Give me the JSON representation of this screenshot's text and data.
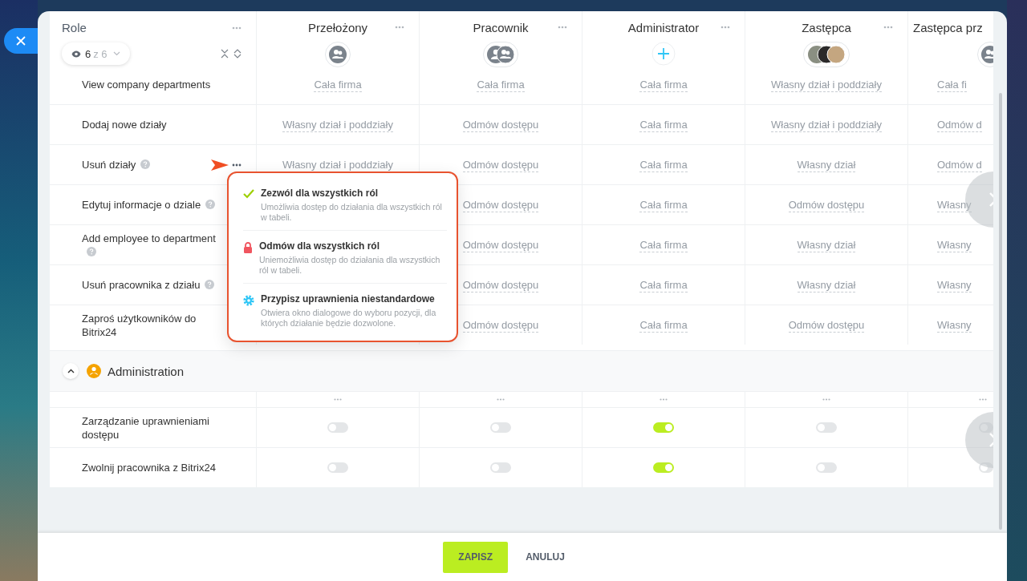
{
  "roles": {
    "title": "Role",
    "filter": {
      "count": "6",
      "total": "z 6"
    }
  },
  "columns": [
    {
      "name": "Przełożony",
      "avatar": {
        "kind": "group"
      }
    },
    {
      "name": "Pracownik",
      "avatar": {
        "kind": "user_group"
      }
    },
    {
      "name": "Administrator",
      "avatar": {
        "kind": "add"
      }
    },
    {
      "name": "Zastępca",
      "avatar": {
        "kind": "photos"
      }
    },
    {
      "name": "Zastępca prz",
      "avatar": {
        "kind": "group"
      }
    }
  ],
  "rows": [
    {
      "label": "View company departments",
      "help": false,
      "values": [
        "Cała firma",
        "Cała firma",
        "Cała firma",
        "Własny dział i poddziały",
        "Cała fi"
      ]
    },
    {
      "label": "Dodaj nowe działy",
      "help": false,
      "values": [
        "Własny dział i poddziały",
        "Odmów dostępu",
        "Cała firma",
        "Własny dział i poddziały",
        "Odmów d"
      ]
    },
    {
      "label": "Usuń działy",
      "help": true,
      "values": [
        "Własny dział i poddziały",
        "Odmów dostępu",
        "Cała firma",
        "Własny dział",
        "Odmów d"
      ],
      "context_menu": {
        "items": [
          {
            "kind": "allow",
            "title": "Zezwól dla wszystkich ról",
            "description": "Umożliwia dostęp do działania dla wszystkich ról w tabeli."
          },
          {
            "kind": "deny",
            "title": "Odmów dla wszystkich ról",
            "description": "Uniemożliwia dostęp do działania dla wszystkich ról w tabeli."
          },
          {
            "kind": "custom",
            "title": "Przypisz uprawnienia niestandardowe",
            "description": "Otwiera okno dialogowe do wyboru pozycji, dla których działanie będzie dozwolone."
          }
        ]
      }
    },
    {
      "label": "Edytuj informacje o dziale",
      "help": true,
      "values": [
        "Odmów dostępu",
        "Cała firma",
        "Odmów dostępu",
        "Własny"
      ]
    },
    {
      "label": "Add employee to department",
      "help": true,
      "values": [
        "Odmów dostępu",
        "Cała firma",
        "Własny dział",
        "Własny"
      ]
    },
    {
      "label": "Usuń pracownika z działu",
      "help": true,
      "values": [
        "Odmów dostępu",
        "Cała firma",
        "Własny dział",
        "Własny"
      ]
    },
    {
      "label": "Zaproś użytkowników do Bitrix24",
      "help": false,
      "values": [
        "Odmów dostępu",
        "Cała firma",
        "Odmów dostępu",
        "Własny"
      ]
    }
  ],
  "section": {
    "title": "Administration",
    "expanded": true,
    "rows": [
      {
        "label": "Zarządzanie uprawnieniami dostępu",
        "toggles": [
          {
            "on": false
          },
          {
            "on": false
          },
          {
            "on": true
          },
          {
            "on": false
          },
          {
            "on": false
          }
        ]
      },
      {
        "label": "Zwolnij pracownika z Bitrix24",
        "toggles": [
          {
            "on": false
          },
          {
            "on": false
          },
          {
            "on": true
          },
          {
            "on": false
          },
          {
            "on": false
          }
        ]
      }
    ]
  },
  "footer": {
    "save": "ZAPISZ",
    "cancel": "ANULUJ"
  }
}
